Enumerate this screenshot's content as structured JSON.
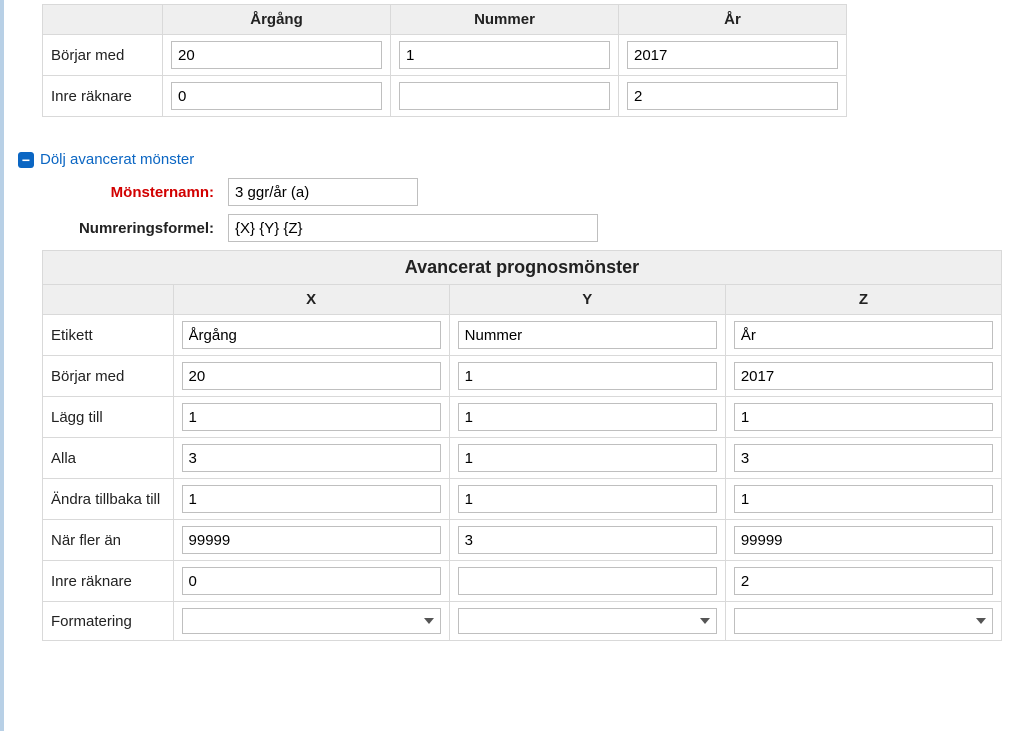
{
  "summary": {
    "headers": {
      "argang": "Årgång",
      "nummer": "Nummer",
      "ar": "År"
    },
    "rows": [
      {
        "label": "Börjar med",
        "argang": "20",
        "nummer": "1",
        "ar": "2017"
      },
      {
        "label": "Inre räknare",
        "argang": "0",
        "nummer": "",
        "ar": "2"
      }
    ]
  },
  "toggle": {
    "icon": "−",
    "label": "Dölj avancerat mönster"
  },
  "pattern": {
    "name_label": "Mönsternamn:",
    "name_value": "3 ggr/år (a)",
    "formula_label": "Numreringsformel:",
    "formula_value": "{X} {Y} {Z}"
  },
  "advanced": {
    "title": "Avancerat prognosmönster",
    "cols": {
      "x": "X",
      "y": "Y",
      "z": "Z"
    },
    "rows": {
      "etikett": {
        "label": "Etikett",
        "x": "Årgång",
        "y": "Nummer",
        "z": "År"
      },
      "borjar_med": {
        "label": "Börjar med",
        "x": "20",
        "y": "1",
        "z": "2017"
      },
      "lagg_till": {
        "label": "Lägg till",
        "x": "1",
        "y": "1",
        "z": "1"
      },
      "alla": {
        "label": "Alla",
        "x": "3",
        "y": "1",
        "z": "3"
      },
      "andra_tillbaka": {
        "label": "Ändra tillbaka till",
        "x": "1",
        "y": "1",
        "z": "1"
      },
      "nar_fler_an": {
        "label": "När fler än",
        "x": "99999",
        "y": "3",
        "z": "99999"
      },
      "inre_raknare": {
        "label": "Inre räknare",
        "x": "0",
        "y": "",
        "z": "2"
      },
      "formatering": {
        "label": "Formatering",
        "x": "",
        "y": "",
        "z": ""
      }
    }
  }
}
